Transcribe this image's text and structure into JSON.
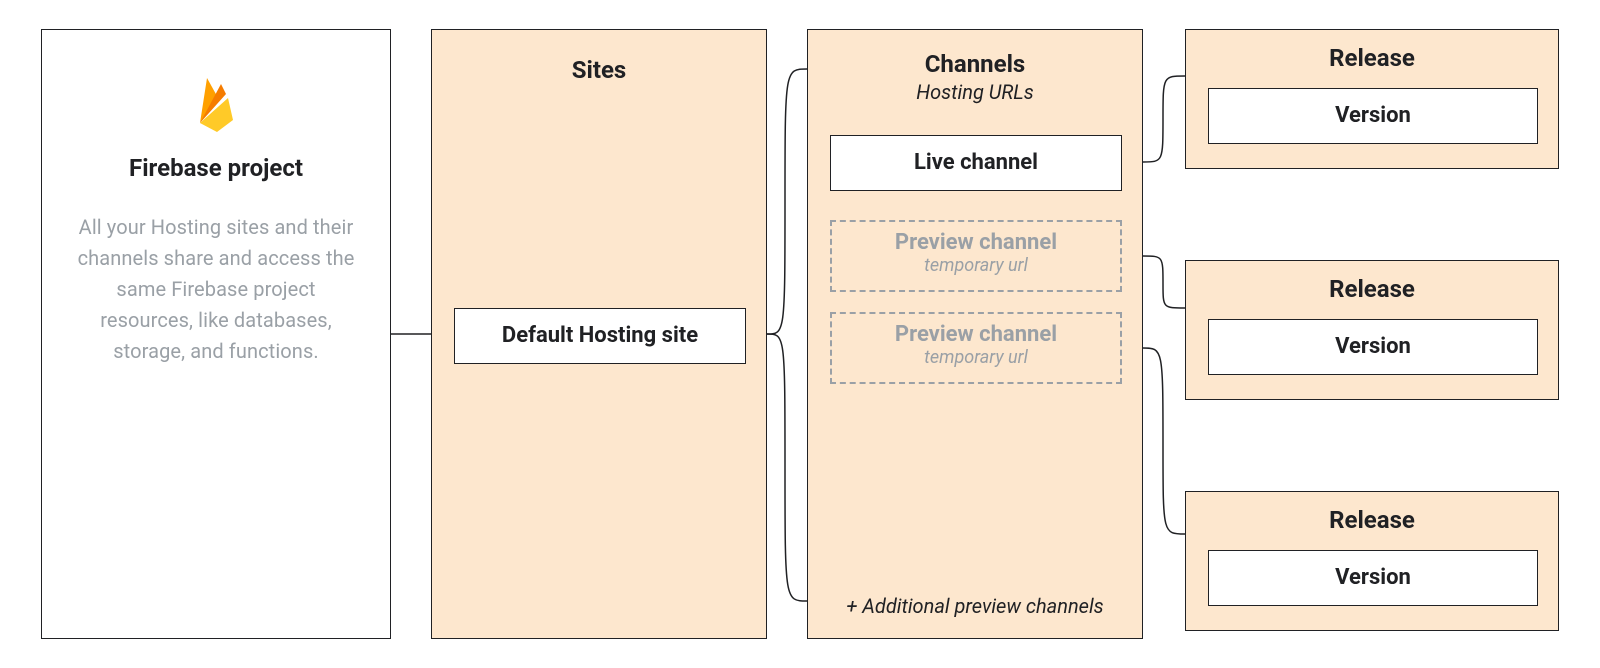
{
  "project": {
    "title": "Firebase project",
    "description": "All your Hosting sites and their channels share and access the same Firebase project resources, like databases, storage, and functions."
  },
  "sites": {
    "title": "Sites",
    "default_site": "Default Hosting site"
  },
  "channels": {
    "title": "Channels",
    "subtitle": "Hosting URLs",
    "live_label": "Live channel",
    "preview_label": "Preview channel",
    "preview_sub": "temporary url",
    "additional": "+ Additional preview channels"
  },
  "release": {
    "title": "Release",
    "version": "Version"
  }
}
